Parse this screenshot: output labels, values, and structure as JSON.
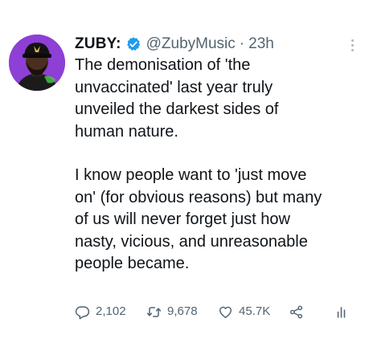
{
  "author": {
    "display_name": "ZUBY:",
    "handle": "@ZubyMusic",
    "separator": "·",
    "timestamp": "23h",
    "verified": true,
    "avatar_bg": "#8d3fd6"
  },
  "tweet": {
    "paragraphs": [
      "The demonisation of 'the\nunvaccinated' last year truly\nunveiled the darkest sides of\nhuman nature.",
      "I know people want to 'just move\non' (for obvious reasons) but many\nof us will never forget just how\nnasty, vicious, and unreasonable\npeople became."
    ]
  },
  "actions": {
    "replies": "2,102",
    "retweets": "9,678",
    "likes": "45.7K",
    "share_icon": "share-icon",
    "analytics_icon": "analytics-icon"
  },
  "colors": {
    "text_primary": "#0f1419",
    "text_secondary": "#536471",
    "verified_blue": "#1d9bf0"
  }
}
